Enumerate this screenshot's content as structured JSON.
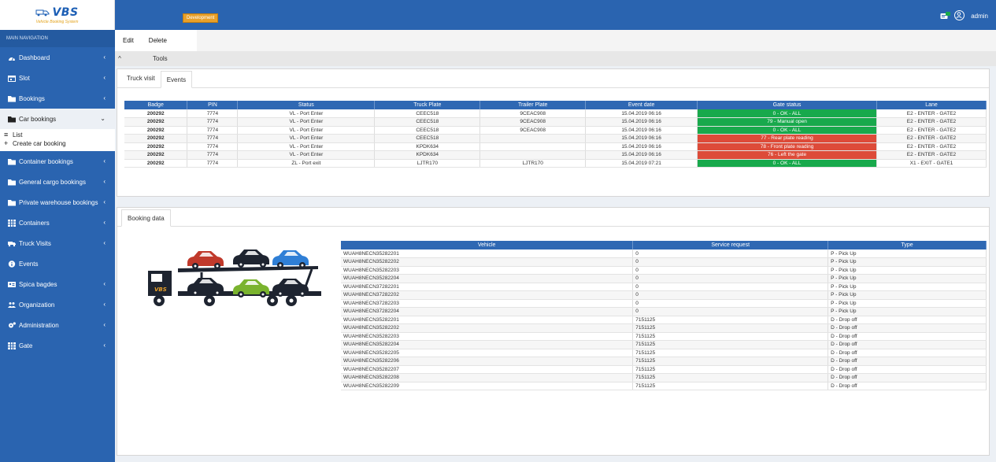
{
  "app": {
    "logo_text": "VBS",
    "logo_subtitle": "Vehicle Booking System",
    "env_badge": "Development",
    "user": "admin"
  },
  "sidebar": {
    "header": "MAIN NAVIGATION",
    "items": [
      {
        "label": "Dashboard",
        "icon": "dashboard-icon",
        "chevron": "‹"
      },
      {
        "label": "Slot",
        "icon": "calendar-icon",
        "chevron": "‹"
      },
      {
        "label": "Bookings",
        "icon": "folder-icon",
        "chevron": "‹"
      },
      {
        "label": "Car bookings",
        "icon": "folder-icon",
        "chevron": "⌄"
      },
      {
        "label": "Container bookings",
        "icon": "folder-icon",
        "chevron": "‹"
      },
      {
        "label": "General cargo bookings",
        "icon": "folder-icon",
        "chevron": "‹"
      },
      {
        "label": "Private warehouse bookings",
        "icon": "folder-icon",
        "chevron": "‹"
      },
      {
        "label": "Containers",
        "icon": "grid-icon",
        "chevron": "‹"
      },
      {
        "label": "Truck Visits",
        "icon": "truck-icon",
        "chevron": "‹"
      },
      {
        "label": "Events",
        "icon": "info-icon",
        "chevron": ""
      },
      {
        "label": "Spica bagdes",
        "icon": "id-card-icon",
        "chevron": "‹"
      },
      {
        "label": "Organization",
        "icon": "users-icon",
        "chevron": "‹"
      },
      {
        "label": "Administration",
        "icon": "gears-icon",
        "chevron": "‹"
      },
      {
        "label": "Gate",
        "icon": "grid-icon",
        "chevron": "‹"
      }
    ],
    "submenu": [
      {
        "label": "List",
        "icon": "≡"
      },
      {
        "label": "Create car booking",
        "icon": "+"
      }
    ]
  },
  "toolbar": {
    "edit_label": "Edit",
    "delete_label": "Delete",
    "tools_label": "Tools",
    "collapse_glyph": "^"
  },
  "top_panel": {
    "tabs": [
      "Truck visit",
      "Events"
    ],
    "columns": [
      "Badge",
      "PIN",
      "Status",
      "Truck Plate",
      "Trailer Plate",
      "Event date",
      "Gate status",
      "Lane"
    ],
    "rows": [
      [
        "200292",
        "7774",
        "VL - Port Enter",
        "CEEC518",
        "9CEAC908",
        "15.04.2019 06:16",
        "0 - OK - ALL",
        "E2 - ENTER - GATE2"
      ],
      [
        "200292",
        "7774",
        "VL - Port Enter",
        "CEEC518",
        "9CEAC908",
        "15.04.2019 06:16",
        "79 - Manual open",
        "E2 - ENTER - GATE2"
      ],
      [
        "200292",
        "7774",
        "VL - Port Enter",
        "CEEC518",
        "9CEAC908",
        "15.04.2019 06:16",
        "0 - OK - ALL",
        "E2 - ENTER - GATE2"
      ],
      [
        "200292",
        "7774",
        "VL - Port Enter",
        "CEEC518",
        "",
        "15.04.2019 06:16",
        "77 - Rear plate reading",
        "E2 - ENTER - GATE2"
      ],
      [
        "200292",
        "7774",
        "VL - Port Enter",
        "KPDK634",
        "",
        "15.04.2019 06:16",
        "78 - Front plate reading",
        "E2 - ENTER - GATE2"
      ],
      [
        "200292",
        "7774",
        "VL - Port Enter",
        "KPDK634",
        "",
        "15.04.2019 06:16",
        "76 - Left the gate",
        "E2 - ENTER - GATE2"
      ],
      [
        "200292",
        "7774",
        "ZL - Port exit",
        "LJTR170",
        "LJTR170",
        "15.04.2019 07:21",
        "0 - OK - ALL",
        "X1 - EXIT - GATE1"
      ]
    ],
    "gate_status_colors": [
      "green",
      "green",
      "green",
      "red",
      "red",
      "red",
      "green"
    ],
    "colors": {
      "green": "#18a94c",
      "red": "#dd4b39",
      "header": "#2f68b3"
    }
  },
  "bottom_panel": {
    "tabs": [
      "Booking data"
    ],
    "columns": [
      "Vehicle",
      "Service request",
      "Type"
    ],
    "rows": [
      [
        "WUAH8NECN35282201",
        "0",
        "P - Pick Up"
      ],
      [
        "WUAH8NECN35282202",
        "0",
        "P - Pick Up"
      ],
      [
        "WUAH8NECN35282203",
        "0",
        "P - Pick Up"
      ],
      [
        "WUAH8NECN35282204",
        "0",
        "P - Pick Up"
      ],
      [
        "WUAH8NECN37282201",
        "0",
        "P - Pick Up"
      ],
      [
        "WUAH8NECN37282202",
        "0",
        "P - Pick Up"
      ],
      [
        "WUAH8NECN37282203",
        "0",
        "P - Pick Up"
      ],
      [
        "WUAH8NECN37282204",
        "0",
        "P - Pick Up"
      ],
      [
        "WUAH8NECN35282201",
        "7151125",
        "D - Drop off"
      ],
      [
        "WUAH8NECN35282202",
        "7151125",
        "D - Drop off"
      ],
      [
        "WUAH8NECN35282203",
        "7151125",
        "D - Drop off"
      ],
      [
        "WUAH8NECN35282204",
        "7151125",
        "D - Drop off"
      ],
      [
        "WUAH8NECN35282205",
        "7151125",
        "D - Drop off"
      ],
      [
        "WUAH8NECN35282206",
        "7151125",
        "D - Drop off"
      ],
      [
        "WUAH8NECN35282207",
        "7151125",
        "D - Drop off"
      ],
      [
        "WUAH8NECN35282208",
        "7151125",
        "D - Drop off"
      ],
      [
        "WUAH8NECN35282209",
        "7151125",
        "D - Drop off"
      ]
    ]
  },
  "illustration": {
    "name": "car-transport-truck-icon",
    "truck_text": "VBS",
    "car_colors": [
      "#c0392b",
      "#1e2430",
      "#2f7fd6",
      "#1e2430",
      "#7ab32e",
      "#1e2430"
    ]
  }
}
